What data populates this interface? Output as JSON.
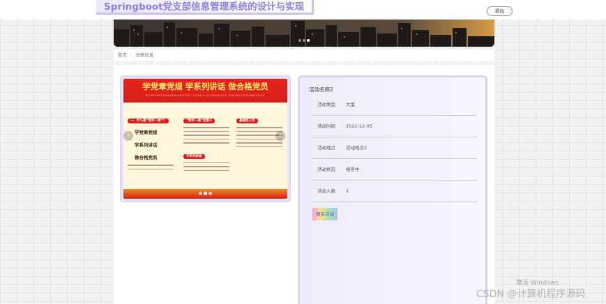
{
  "header": {
    "site_title": "Springboot党支部信息管理系统的设计与实现",
    "logout_label": "退出"
  },
  "breadcrumb": {
    "home": "首页",
    "current": "详情信息"
  },
  "gallery": {
    "poster": {
      "headline": "学党章党规 学系列讲话 做合格党员",
      "subheadline": "XUEDANGZHANGDANGGUI XUEXILIEJIANGHUA ZUOHEGEDANGYUAN",
      "calligraphy": [
        "学党章党规",
        "学系列讲话",
        "做合格党员"
      ],
      "section_1": "一、什么是“两学一做”？",
      "section_2": "“两学一做”的意义",
      "section_3": "基础性工作",
      "section_4": "学系列讲话"
    },
    "arrow_prev": "‹",
    "arrow_next": "›",
    "slide_count": 3,
    "active_slide": 2
  },
  "activity": {
    "name": "活动名称2",
    "fields": [
      {
        "label": "活动类型",
        "value": "大型"
      },
      {
        "label": "活动时间",
        "value": "2022-12-05"
      },
      {
        "label": "活动地点",
        "value": "活动地点2"
      },
      {
        "label": "活动状态",
        "value": "报名中"
      },
      {
        "label": "活动人数",
        "value": "2"
      }
    ],
    "signup_label": "报名活动"
  },
  "colors": {
    "title_text": "#8f7fdf",
    "panel_border": "#d8d3f2",
    "poster_red": "#d81e1b",
    "poster_gold": "#ffe66b"
  },
  "watermarks": {
    "windows": "激活 Windows",
    "csdn": "CSDN @计算机程序源码"
  }
}
